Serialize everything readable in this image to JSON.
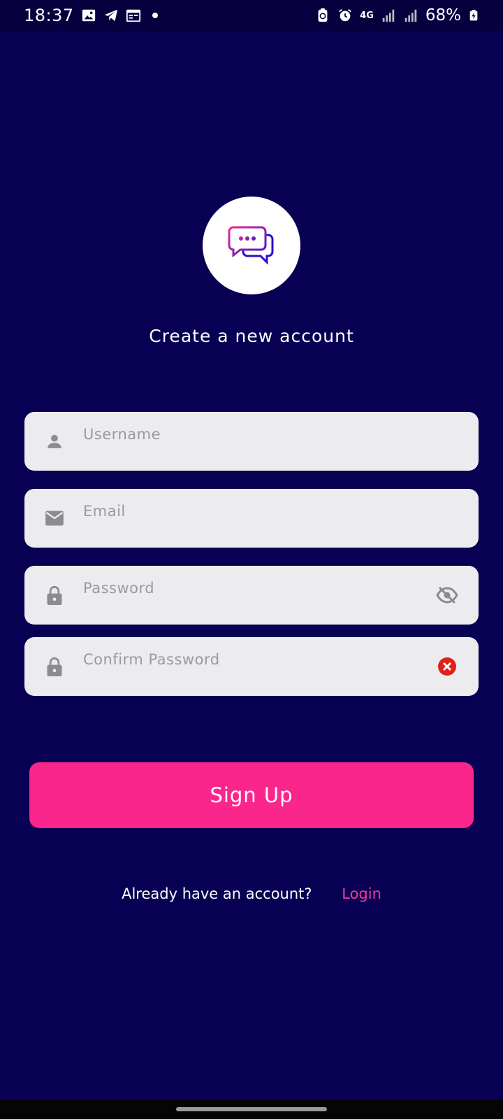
{
  "status_bar": {
    "time": "18:37",
    "network": "4G",
    "battery": "68%"
  },
  "app": {
    "logo_icon": "chat-bubbles-icon",
    "title": "Create a new account"
  },
  "form": {
    "username": {
      "placeholder": "Username",
      "value": "",
      "icon": "person-icon"
    },
    "email": {
      "placeholder": "Email",
      "value": "",
      "icon": "mail-icon"
    },
    "password": {
      "placeholder": "Password",
      "value": "",
      "icon": "lock-icon",
      "trailing_icon": "eye-off-icon"
    },
    "confirm_password": {
      "placeholder": "Confirm Password",
      "value": "",
      "icon": "lock-icon",
      "trailing_icon": "error-icon"
    },
    "submit_label": "Sign Up"
  },
  "footer": {
    "question": "Already have an account?",
    "link_label": "Login"
  },
  "colors": {
    "background": "#080052",
    "accent": "#fb268c",
    "field": "#ececee",
    "error": "#e0201b"
  }
}
